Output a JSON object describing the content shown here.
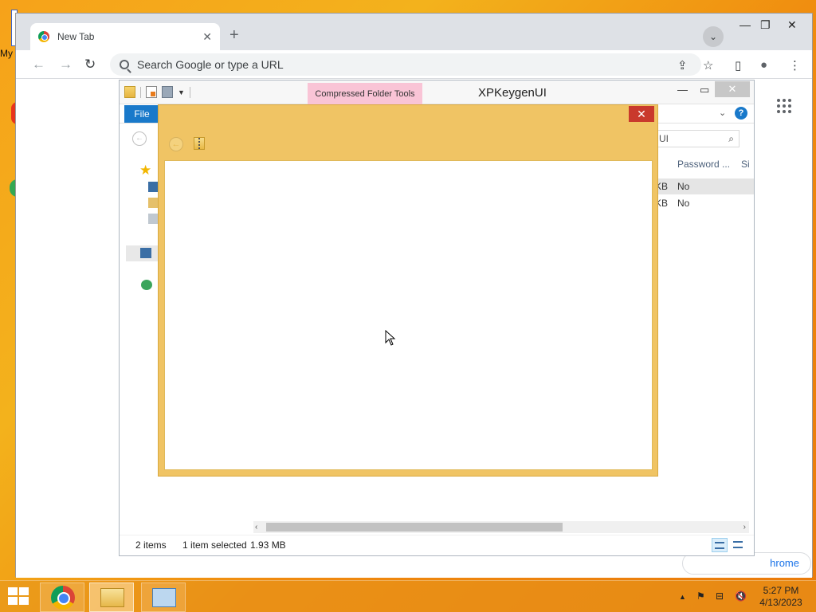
{
  "desktop": {
    "label_fragment": "My"
  },
  "chrome": {
    "tab_title": "New Tab",
    "tab_close": "✕",
    "new_tab": "+",
    "tab_search": "⌄",
    "window_min": "—",
    "window_max": "❐",
    "window_close": "✕",
    "nav_back": "←",
    "nav_forward": "→",
    "nav_reload": "↻",
    "omnibox_placeholder": "Search Google or type a URL",
    "share_icon": "⇪",
    "bookmark_icon": "☆",
    "sidepanel_icon": "▯",
    "profile_icon": "●",
    "menu_icon": "⋮",
    "customize_label": "hrome"
  },
  "explorer": {
    "contextual_tab": "Compressed Folder Tools",
    "window_title": "XPKeygenUI",
    "ribbon_file": "File",
    "help": "?",
    "ribbon_expand": "⌄",
    "search_value": "UI",
    "search_icon": "⌕",
    "columns": [
      "Password ...",
      "Si"
    ],
    "rows": [
      {
        "size_frag": "KB",
        "password": "No",
        "selected": true
      },
      {
        "size_frag": "KB",
        "password": "No",
        "selected": false
      }
    ],
    "status_items": "2 items",
    "status_selected": "1 item selected",
    "status_size": "1.93 MB",
    "scroll_left": "‹",
    "scroll_right": "›",
    "min": "—",
    "max": "▭",
    "close": "✕"
  },
  "dialog": {
    "close": "✕",
    "back": "←"
  },
  "taskbar": {
    "time": "5:27 PM",
    "date": "4/13/2023",
    "tray_expand": "▲",
    "flag_icon": "⚑",
    "network_icon": "⊟",
    "volume_icon": "🔇"
  }
}
